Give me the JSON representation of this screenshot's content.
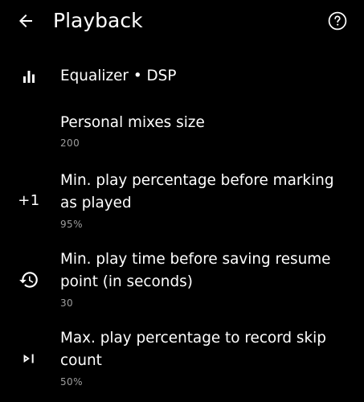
{
  "header": {
    "title": "Playback",
    "back_icon": "arrow-left-icon",
    "help_icon": "help-circle-icon"
  },
  "items": [
    {
      "title_lines": [
        "Equalizer • DSP"
      ],
      "summary": "",
      "icon": "equalizer-icon"
    },
    {
      "title_lines": [
        "Personal mixes size"
      ],
      "summary": "200",
      "icon": ""
    },
    {
      "title_lines": [
        "Min. play percentage before marking",
        "as played"
      ],
      "summary": "95%",
      "icon": "plus-one-icon",
      "icon_text": "+1"
    },
    {
      "title_lines": [
        "Min. play time before saving resume",
        "point (in seconds)"
      ],
      "summary": "30",
      "icon": "history-icon"
    },
    {
      "title_lines": [
        "Max. play percentage to record skip",
        "count"
      ],
      "summary": "50%",
      "icon": "skip-next-icon"
    }
  ],
  "colors": {
    "background": "#000000",
    "text_primary": "#ffffff",
    "text_secondary": "#9e9e9e"
  }
}
